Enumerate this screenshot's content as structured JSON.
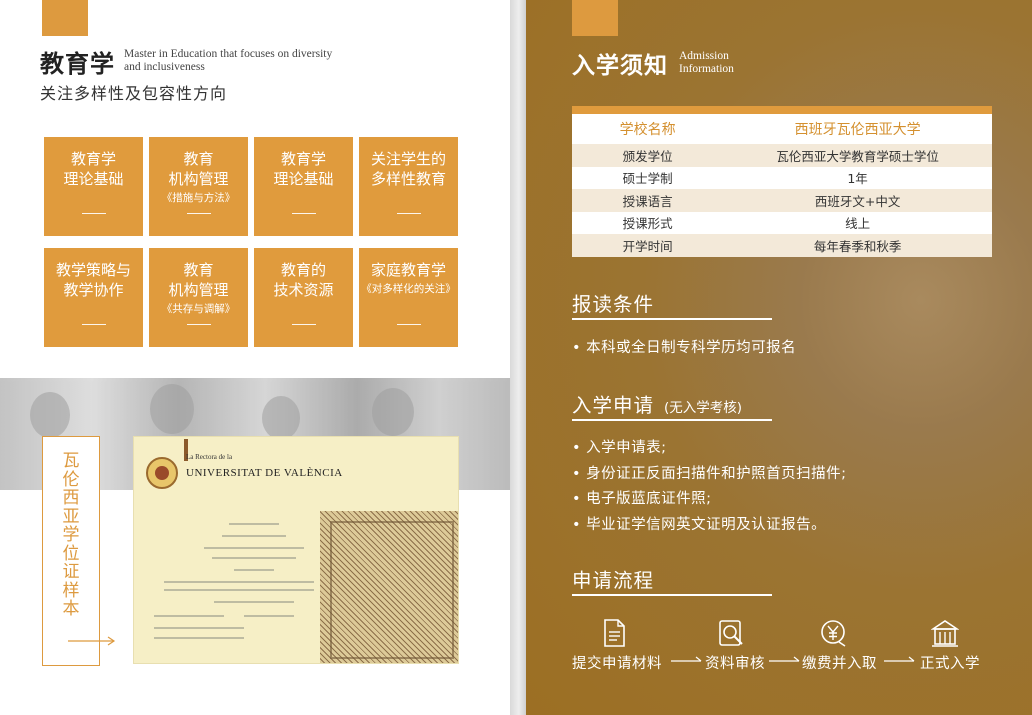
{
  "left_page": {
    "title": "教育学",
    "title_en": "Master in Education that focuses on diversity and inclusiveness",
    "subtitle": "关注多样性及包容性方向",
    "tiles": [
      {
        "line1": "教育学",
        "line2": "理论基础",
        "note": ""
      },
      {
        "line1": "教育",
        "line2": "机构管理",
        "note": "《措施与方法》"
      },
      {
        "line1": "教育学",
        "line2": "理论基础",
        "note": ""
      },
      {
        "line1": "关注学生的",
        "line2": "多样性教育",
        "note": ""
      },
      {
        "line1": "教学策略与",
        "line2": "教学协作",
        "note": ""
      },
      {
        "line1": "教育",
        "line2": "机构管理",
        "note": "《共存与调解》"
      },
      {
        "line1": "教育的",
        "line2": "技术资源",
        "note": ""
      },
      {
        "line1": "家庭教育学",
        "line2": "",
        "note": "《对多样化的关注》"
      }
    ],
    "certificate_label": "瓦伦西亚学位证样本",
    "certificate": {
      "header_small": "La Rectora de la",
      "header_name": "UNIVERSITAT DE VALÈNCIA"
    }
  },
  "right_page": {
    "title": "入学须知",
    "title_en_line1": "Admission",
    "title_en_line2": "Information",
    "info_table": {
      "header": [
        "学校名称",
        "西班牙瓦伦西亚大学"
      ],
      "rows": [
        [
          "颁发学位",
          "瓦伦西亚大学教育学硕士学位"
        ],
        [
          "硕士学制",
          "1年"
        ],
        [
          "授课语言",
          "西班牙文+中文"
        ],
        [
          "授课形式",
          "线上"
        ],
        [
          "开学时间",
          "每年春季和秋季"
        ]
      ]
    },
    "requirements": {
      "heading": "报读条件",
      "items": [
        "本科或全日制专科学历均可报名"
      ]
    },
    "application": {
      "heading": "入学申请",
      "note": "(无入学考核)",
      "items": [
        "入学申请表;",
        "身份证正反面扫描件和护照首页扫描件;",
        "电子版蓝底证件照;",
        "毕业证学信网英文证明及认证报告。"
      ]
    },
    "process": {
      "heading": "申请流程",
      "steps": [
        {
          "label": "提交申请材料",
          "icon": "document-icon"
        },
        {
          "label": "资料审核",
          "icon": "search-review-icon"
        },
        {
          "label": "缴费并入取",
          "icon": "yen-payment-icon"
        },
        {
          "label": "正式入学",
          "icon": "school-building-icon"
        }
      ]
    }
  },
  "colors": {
    "accent": "#e09b3d",
    "right_background": "#9c6f23",
    "table_alt_row": "#f3e9d9",
    "text_dark": "#222222"
  }
}
